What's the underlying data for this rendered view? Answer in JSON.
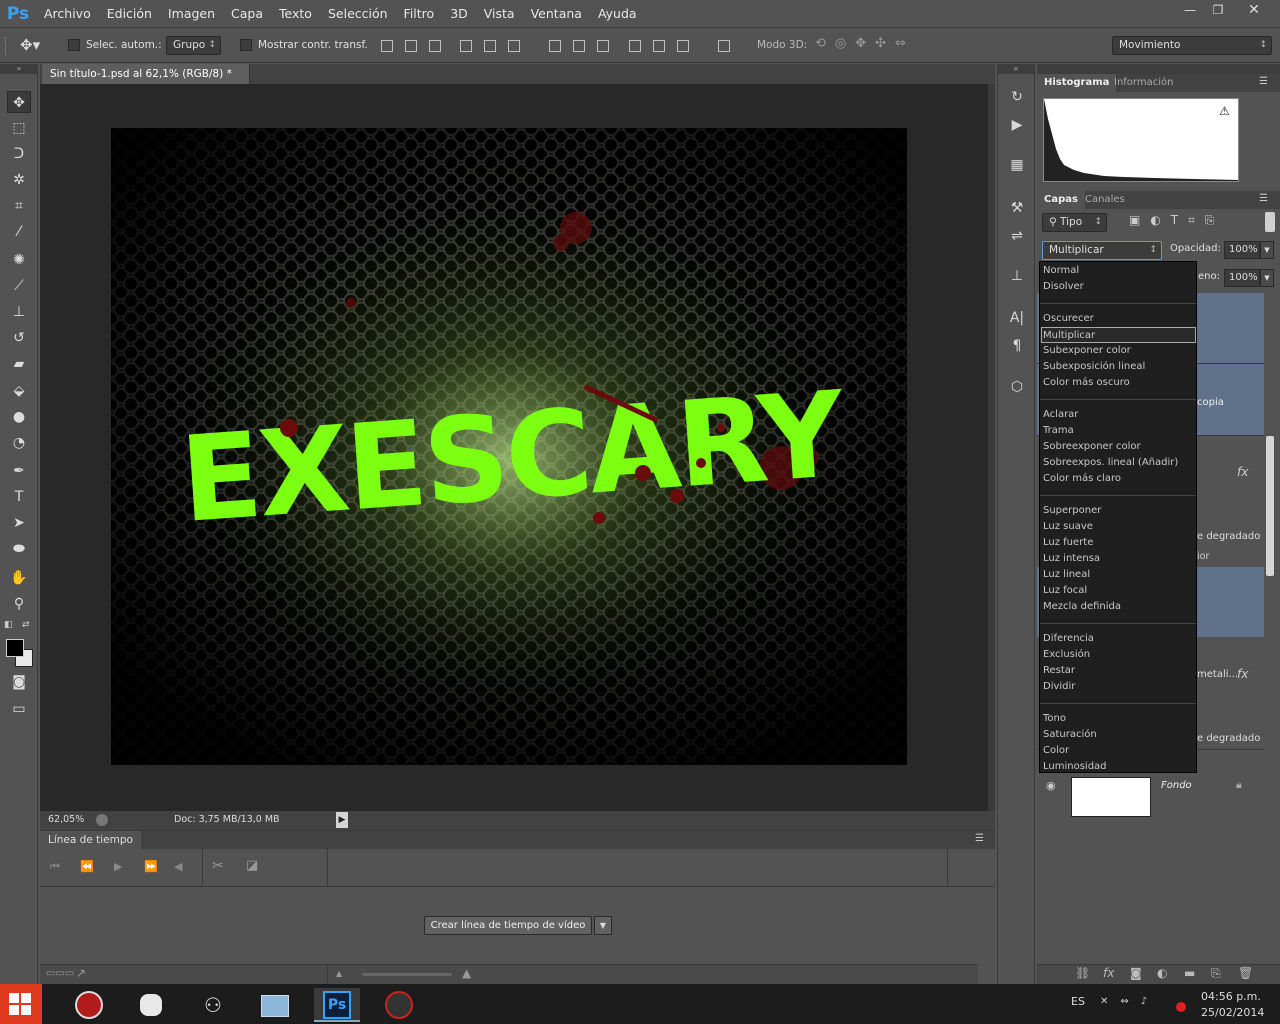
{
  "app": {
    "logo": "Ps"
  },
  "menu": [
    "Archivo",
    "Edición",
    "Imagen",
    "Capa",
    "Texto",
    "Selección",
    "Filtro",
    "3D",
    "Vista",
    "Ventana",
    "Ayuda"
  ],
  "window_controls": {
    "minimize": "—",
    "restore": "❐",
    "close": "✕"
  },
  "options": {
    "auto_select_label": "Selec. autom.:",
    "auto_select_value": "Grupo",
    "show_transform_label": "Mostrar contr. transf.",
    "mode3d_label": "Modo 3D:",
    "workspace": "Movimiento"
  },
  "document": {
    "tab_title": "Sin título-1.psd al 62,1% (RGB/8) *",
    "tab_close": "×",
    "artwork_text": "EXESCARY",
    "zoom": "62,05%",
    "doc_info": "Doc: 3,75 MB/13,0 MB"
  },
  "timeline": {
    "title": "Línea de tiempo",
    "create_button": "Crear línea de tiempo de vídeo"
  },
  "histogram_panel": {
    "tabs": [
      "Histograma",
      "Información"
    ],
    "warning": "⚠"
  },
  "layers_panel": {
    "tabs": [
      "Capas",
      "Canales"
    ],
    "filter_label": "Tipo",
    "blend_mode": "Multiplicar",
    "opacity_label": "Opacidad:",
    "opacity_value": "100%",
    "fill_label": "eno:",
    "fill_value": "100%",
    "layer_fragments": [
      "copia",
      "e degradado",
      "ior",
      "metali...",
      "e degradado"
    ],
    "fx": "fx",
    "background_layer": "Fondo"
  },
  "blend_menu": {
    "groups": [
      [
        "Normal",
        "Disolver"
      ],
      [
        "Oscurecer",
        "Multiplicar",
        "Subexponer color",
        "Subexposición lineal",
        "Color más oscuro"
      ],
      [
        "Aclarar",
        "Trama",
        "Sobreexponer color",
        "Sobreexpos. lineal (Añadir)",
        "Color más claro"
      ],
      [
        "Superponer",
        "Luz suave",
        "Luz fuerte",
        "Luz intensa",
        "Luz lineal",
        "Luz focal",
        "Mezcla definida"
      ],
      [
        "Diferencia",
        "Exclusión",
        "Restar",
        "Dividir"
      ],
      [
        "Tono",
        "Saturación",
        "Color",
        "Luminosidad"
      ]
    ],
    "selected": "Multiplicar"
  },
  "taskbar": {
    "language": "ES",
    "time": "04:56 p.m.",
    "date": "25/02/2014",
    "ps_icon": "Ps"
  },
  "colors": {
    "accent_green": "#7dff12",
    "ps_blue": "#3ba1ff",
    "panel_bg": "#535353",
    "dark_bg": "#282828"
  }
}
